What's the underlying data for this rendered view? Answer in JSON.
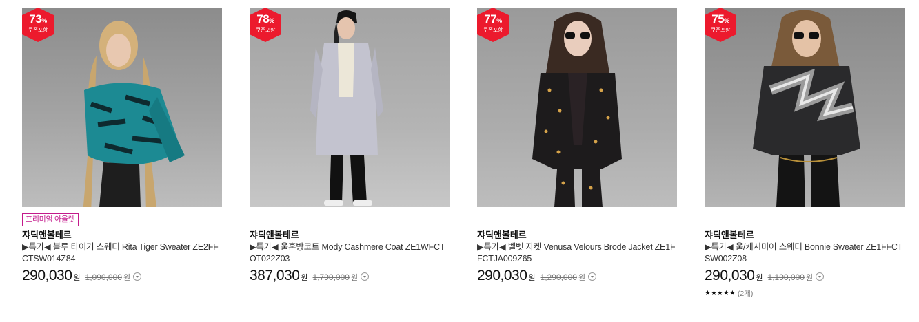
{
  "products": [
    {
      "discount": "73",
      "percent_sign": "%",
      "coupon_label": "쿠폰포함",
      "tag": "프리미엄 아울렛",
      "brand": "쟈딕앤볼테르",
      "title": "▶특가◀ 블루 타이거 스웨터 Rita Tiger Sweater ZE2FFCTSW014Z84",
      "price": "290,030",
      "currency": "원",
      "original_price": "1,090,000",
      "image": "model-blue-tiger-sweater"
    },
    {
      "discount": "78",
      "percent_sign": "%",
      "coupon_label": "쿠폰포함",
      "brand": "쟈딕앤볼테르",
      "title": "▶특가◀ 울혼방코트 Mody Cashmere Coat ZE1WFCTOT022Z03",
      "price": "387,030",
      "currency": "원",
      "original_price": "1,790,000",
      "image": "model-grey-wool-coat"
    },
    {
      "discount": "77",
      "percent_sign": "%",
      "coupon_label": "쿠폰포함",
      "brand": "쟈딕앤볼테르",
      "title": "▶특가◀ 벨벳 자켓 Venusa Velours Brode Jacket ZE1FFCTJA009Z65",
      "price": "290,030",
      "currency": "원",
      "original_price": "1,290,000",
      "image": "model-black-velvet-jacket"
    },
    {
      "discount": "75",
      "percent_sign": "%",
      "coupon_label": "쿠폰포함",
      "brand": "쟈딕앤볼테르",
      "title": "▶특가◀ 울/캐시미어 스웨터 Bonnie Sweater ZE1FFCTSW002Z08",
      "price": "290,030",
      "currency": "원",
      "original_price": "1,190,000",
      "image": "model-grey-zigzag-sweater",
      "stars": "★★★★★",
      "rating": 5,
      "review_count": "(2개)"
    }
  ],
  "colors": {
    "badge": "#ec1a2d",
    "outlet_tag": "#c3198b"
  }
}
